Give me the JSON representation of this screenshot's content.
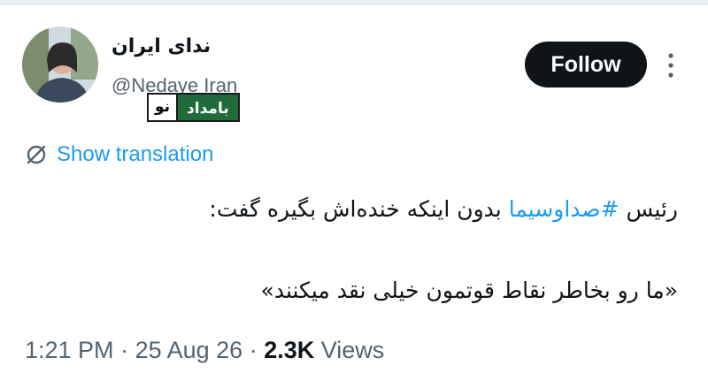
{
  "author": {
    "display_name": "ندای ایران",
    "handle": "@Nedaye Iran"
  },
  "watermark": {
    "left_text": "نو",
    "right_text": "بامداد"
  },
  "follow_button": {
    "label": "Follow"
  },
  "translation": {
    "label": "Show translation"
  },
  "tweet": {
    "line1_before": "رئیس ",
    "hashtag": "#صداوسیما",
    "line1_after": " بدون اینکه خنده‌اش بگیره گفت:",
    "line2": "«ما رو بخاطر نقاط قوتمون خیلی نقد میکنند»"
  },
  "meta": {
    "time": "1:21 PM",
    "sep1": " · ",
    "date": "25 Aug 26",
    "sep2": " · ",
    "views_count": "2.3K",
    "views_label": " Views"
  },
  "colors": {
    "link": "#1d9bf0",
    "text": "#0f1419",
    "secondary": "#536471",
    "button_bg": "#0f1419",
    "watermark_green": "#1f6b3a"
  },
  "icons": {
    "more": "more-vertical-icon",
    "translate": "globe-slash-icon"
  }
}
